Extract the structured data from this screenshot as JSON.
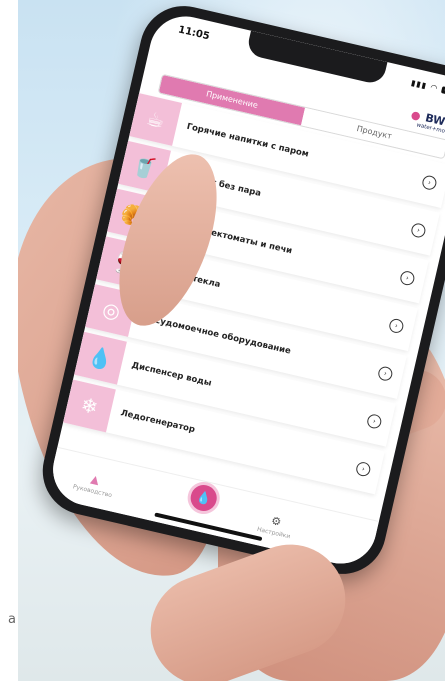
{
  "status": {
    "time": "11:05",
    "battery": "82"
  },
  "brand": {
    "name": "BWT",
    "tagline": "water+more"
  },
  "tabs": [
    {
      "label": "Применение",
      "active": true
    },
    {
      "label": "Продукт",
      "active": false
    }
  ],
  "items": [
    {
      "label": "Горячие напитки с паром",
      "icon": "coffee-cup-icon",
      "glyph": "☕"
    },
    {
      "label": "Вендинг без пара",
      "icon": "cup-icon",
      "glyph": "🥤"
    },
    {
      "label": "Пароконвектоматы и печи",
      "icon": "croissant-icon",
      "glyph": "🥐"
    },
    {
      "label": "Мойка стекла",
      "icon": "wine-glass-icon",
      "glyph": "🍷"
    },
    {
      "label": "Посудомоечное оборудование",
      "icon": "plate-icon",
      "glyph": "◎"
    },
    {
      "label": "Диспенсер воды",
      "icon": "water-drop-icon",
      "glyph": "💧"
    },
    {
      "label": "Ледогенератор",
      "icon": "snowflake-icon",
      "glyph": "❄"
    }
  ],
  "tabbar": {
    "left_label": "Руководство",
    "right_label": "Настройки"
  },
  "colors": {
    "accent": "#e07ab0",
    "tile": "#f3bfd8",
    "brand_pink": "#d94a8c"
  }
}
